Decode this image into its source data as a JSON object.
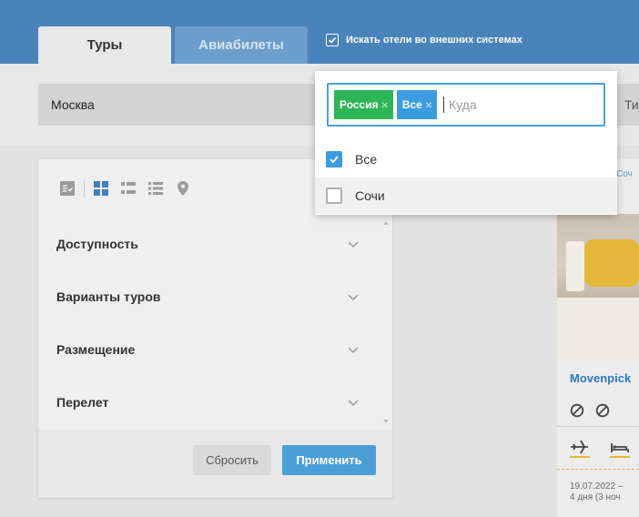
{
  "tabs": {
    "tours": "Туры",
    "avia": "Авиабилеты"
  },
  "external_search": {
    "label": "Искать отели во внешних системах",
    "checked": true
  },
  "search": {
    "from_value": "Москва",
    "type_label": "Ти"
  },
  "destination": {
    "chips": [
      "Россия",
      "Все"
    ],
    "placeholder": "Куда",
    "options": [
      {
        "label": "Все",
        "checked": true
      },
      {
        "label": "Сочи",
        "checked": false
      }
    ]
  },
  "view_icons": [
    "checklist-icon",
    "grid-icon",
    "list-icon",
    "list-detailed-icon",
    "map-pin-icon"
  ],
  "filters": [
    {
      "label": "Доступность"
    },
    {
      "label": "Варианты туров"
    },
    {
      "label": "Размещение"
    },
    {
      "label": "Перелет"
    }
  ],
  "buttons": {
    "reset": "Сбросить",
    "apply": "Применить"
  },
  "hotel": {
    "place": "Соч",
    "name": "Movenpick",
    "date": "19.07.2022 –",
    "duration": "4 дня (3 ноч"
  },
  "colors": {
    "header": "#4a83b9",
    "accent": "#4a9fd8",
    "chip_country": "#2db558",
    "chip_all": "#3d9be0",
    "hotel_name": "#2e78c2",
    "icon_accent": "#e8b530"
  }
}
